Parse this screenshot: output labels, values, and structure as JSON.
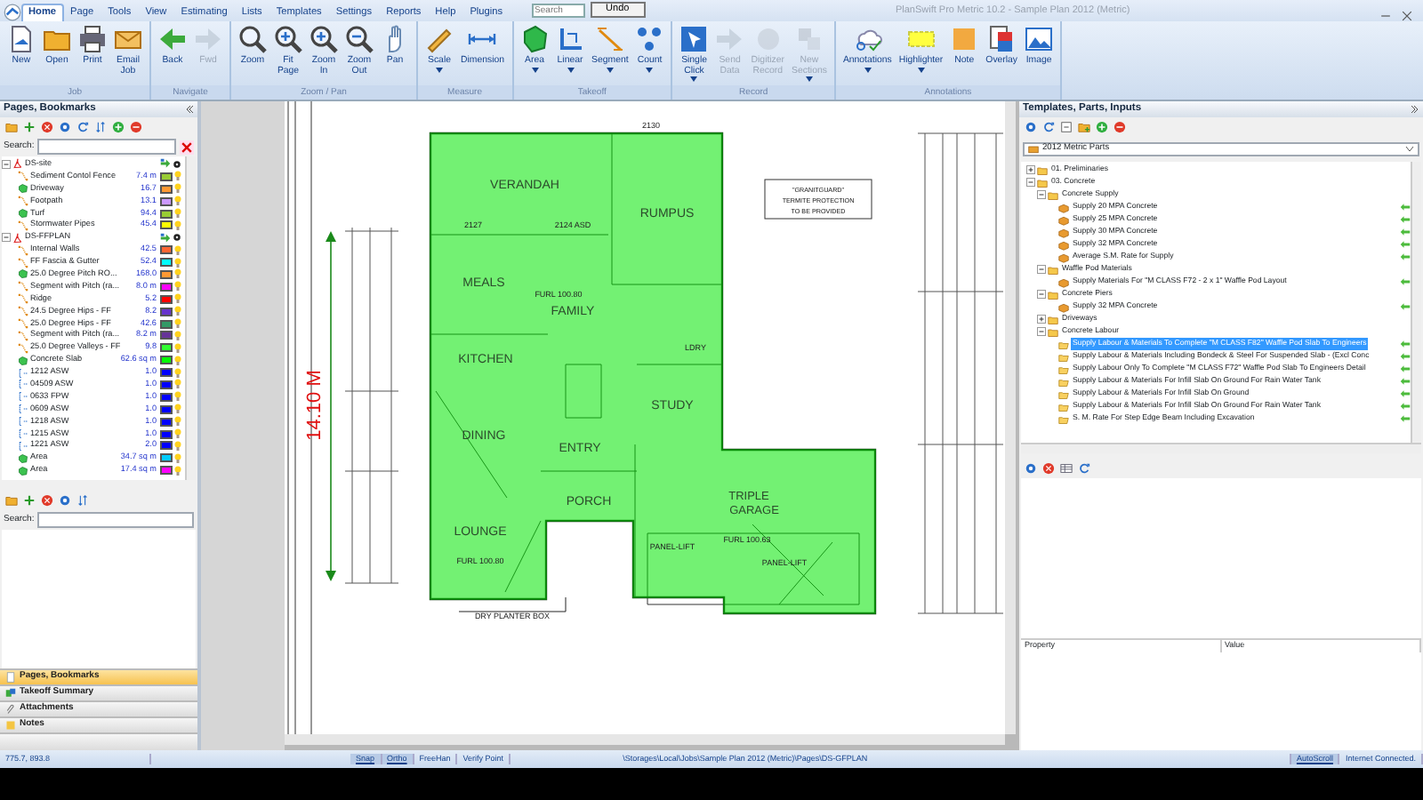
{
  "window": {
    "title": "PlanSwift Pro Metric 10.2 - Sample Plan 2012 (Metric)"
  },
  "menu_tabs": [
    {
      "label": "Home",
      "selected": true
    },
    {
      "label": "Page",
      "selected": false
    },
    {
      "label": "Tools",
      "selected": false
    },
    {
      "label": "View",
      "selected": false
    },
    {
      "label": "Estimating",
      "selected": false
    },
    {
      "label": "Lists",
      "selected": false
    },
    {
      "label": "Templates",
      "selected": false
    },
    {
      "label": "Settings",
      "selected": false
    },
    {
      "label": "Reports",
      "selected": false
    },
    {
      "label": "Help",
      "selected": false
    },
    {
      "label": "Plugins",
      "selected": false
    }
  ],
  "search": {
    "placeholder": "Search"
  },
  "undo_button": "Undo",
  "ribbon": [
    {
      "group": "Job",
      "buttons": [
        {
          "label": "New",
          "disabled": false,
          "dropdown": false
        },
        {
          "label": "Open",
          "disabled": false,
          "dropdown": false
        },
        {
          "label": "Print",
          "disabled": false,
          "dropdown": false
        },
        {
          "label": "Email Job",
          "disabled": false,
          "dropdown": false
        }
      ]
    },
    {
      "group": "Navigate",
      "buttons": [
        {
          "label": "Back",
          "disabled": false,
          "dropdown": false
        },
        {
          "label": "Fwd",
          "disabled": true,
          "dropdown": false
        }
      ]
    },
    {
      "group": "Zoom / Pan",
      "buttons": [
        {
          "label": "Zoom",
          "disabled": false,
          "dropdown": false
        },
        {
          "label": "Fit Page",
          "disabled": false,
          "dropdown": false
        },
        {
          "label": "Zoom In",
          "disabled": false,
          "dropdown": false
        },
        {
          "label": "Zoom Out",
          "disabled": false,
          "dropdown": false
        },
        {
          "label": "Pan",
          "disabled": false,
          "dropdown": false
        }
      ]
    },
    {
      "group": "Measure",
      "buttons": [
        {
          "label": "Scale",
          "disabled": false,
          "dropdown": true
        },
        {
          "label": "Dimension",
          "disabled": false,
          "dropdown": false
        }
      ]
    },
    {
      "group": "Takeoff",
      "buttons": [
        {
          "label": "Area",
          "disabled": false,
          "dropdown": true
        },
        {
          "label": "Linear",
          "disabled": false,
          "dropdown": true
        },
        {
          "label": "Segment",
          "disabled": false,
          "dropdown": true
        },
        {
          "label": "Count",
          "disabled": false,
          "dropdown": true
        }
      ]
    },
    {
      "group": "Record",
      "buttons": [
        {
          "label": "Single Click",
          "disabled": false,
          "dropdown": true
        },
        {
          "label": "Send Data",
          "disabled": true,
          "dropdown": false
        },
        {
          "label": "Digitizer Record",
          "disabled": true,
          "dropdown": false
        },
        {
          "label": "New Sections",
          "disabled": true,
          "dropdown": true
        }
      ]
    },
    {
      "group": "Annotations",
      "buttons": [
        {
          "label": "Annotations",
          "disabled": false,
          "dropdown": true
        },
        {
          "label": "Highlighter",
          "disabled": false,
          "dropdown": true
        },
        {
          "label": "Note",
          "disabled": false,
          "dropdown": false
        },
        {
          "label": "Overlay",
          "disabled": false,
          "dropdown": false
        },
        {
          "label": "Image",
          "disabled": false,
          "dropdown": false
        }
      ]
    }
  ],
  "pages_panel": {
    "title": "Pages, Bookmarks",
    "search_label": "Search:",
    "tree": [
      {
        "label": "DS-site",
        "expanded": true,
        "children": [
          {
            "label": "Sediment Contol Fence",
            "kind": "linear",
            "value": "7.4 m",
            "color": "#99cc33"
          },
          {
            "label": "Driveway",
            "kind": "area",
            "value": "16.7",
            "color": "#ff9933"
          },
          {
            "label": "Footpath",
            "kind": "linear",
            "value": "13.1",
            "color": "#cc99ff"
          },
          {
            "label": "Turf",
            "kind": "area",
            "value": "94.4",
            "color": "#99cc33"
          },
          {
            "label": "Stormwater Pipes",
            "kind": "linear",
            "value": "45.4",
            "color": "#ffff00"
          }
        ]
      },
      {
        "label": "DS-FFPLAN",
        "expanded": true,
        "children": [
          {
            "label": "Internal Walls",
            "kind": "linear",
            "value": "42.5",
            "color": "#ff6633"
          },
          {
            "label": "FF Fascia & Gutter",
            "kind": "linear",
            "value": "52.4",
            "color": "#00ffff"
          },
          {
            "label": "25.0 Degree Pitch  RO...",
            "kind": "area",
            "value": "168.0",
            "color": "#ff9933"
          },
          {
            "label": "Segment with Pitch (ra...",
            "kind": "linear",
            "value": "8.0 m",
            "color": "#ff00ff"
          },
          {
            "label": "Ridge",
            "kind": "linear",
            "value": "5.2",
            "color": "#ff0000"
          },
          {
            "label": "24.5 Degree Hips - FF",
            "kind": "linear",
            "value": "8.2",
            "color": "#6633cc"
          },
          {
            "label": "25.0 Degree Hips - FF",
            "kind": "linear",
            "value": "42.6",
            "color": "#339966"
          },
          {
            "label": "Segment with Pitch (ra...",
            "kind": "linear",
            "value": "8.2 m",
            "color": "#663399"
          },
          {
            "label": "25.0 Degree  Valleys - FF",
            "kind": "linear",
            "value": "9.8",
            "color": "#33ff33"
          },
          {
            "label": "Concrete Slab",
            "kind": "area",
            "value": "62.6 sq m",
            "color": "#00ff00"
          },
          {
            "label": "1212 ASW",
            "kind": "count",
            "value": "1.0",
            "color": "#0000ff"
          },
          {
            "label": "04509 ASW",
            "kind": "count",
            "value": "1.0",
            "color": "#0000ff"
          },
          {
            "label": "0633 FPW",
            "kind": "count",
            "value": "1.0",
            "color": "#0000ff"
          },
          {
            "label": "0609 ASW",
            "kind": "count",
            "value": "1.0",
            "color": "#0000ff"
          },
          {
            "label": "1218 ASW",
            "kind": "count",
            "value": "1.0",
            "color": "#0000ff"
          },
          {
            "label": "1215 ASW",
            "kind": "count",
            "value": "1.0",
            "color": "#0000ff"
          },
          {
            "label": "1221 ASW",
            "kind": "count",
            "value": "2.0",
            "color": "#0000ff"
          },
          {
            "label": "Area",
            "kind": "area",
            "value": "34.7 sq m",
            "color": "#00ccff"
          },
          {
            "label": "Area",
            "kind": "area",
            "value": "17.4 sq m",
            "color": "#ff00ff"
          }
        ]
      }
    ]
  },
  "lower_left_panel": {
    "search_label": "Search:"
  },
  "accordion": [
    {
      "label": "Pages, Bookmarks",
      "selected": true
    },
    {
      "label": "Takeoff Summary",
      "selected": false
    },
    {
      "label": "Attachments",
      "selected": false
    },
    {
      "label": "Notes",
      "selected": false
    }
  ],
  "plan": {
    "labels": [
      "VERANDAH",
      "RUMPUS",
      "MEALS",
      "FAMILY",
      "KITCHEN",
      "DINING",
      "ENTRY",
      "STUDY",
      "PORCH",
      "LOUNGE",
      "TRIPLE",
      "GARAGE",
      "2130",
      "2127",
      "2124 ASD",
      "FURL 100.80",
      "FURL 100.80",
      "FURL 100.63",
      "PANEL-LIFT",
      "PANEL-LIFT",
      "LDRY",
      "DRY PLANTER BOX"
    ],
    "note": [
      "\"GRANITGUARD\"",
      "TERMITE PROTECTION",
      "TO BE PROVIDED"
    ],
    "dimension": "14.10 M"
  },
  "templates_panel": {
    "title": "Templates, Parts, Inputs",
    "dropdown": "2012 Metric Parts",
    "tree": [
      {
        "label": "01. Preliminaries",
        "kind": "folder",
        "expanded": false,
        "selected": false
      },
      {
        "label": "03. Concrete",
        "kind": "folder",
        "expanded": true,
        "selected": false,
        "children": [
          {
            "label": "Concrete Supply",
            "kind": "folder",
            "expanded": true,
            "selected": false,
            "children": [
              {
                "label": "Supply 20 MPA Concrete",
                "kind": "part",
                "selected": false
              },
              {
                "label": "Supply 25 MPA Concrete",
                "kind": "part",
                "selected": false
              },
              {
                "label": "Supply 30 MPA Concrete",
                "kind": "part",
                "selected": false
              },
              {
                "label": "Supply 32 MPA Concrete",
                "kind": "part",
                "selected": false
              },
              {
                "label": "Average S.M. Rate for Supply",
                "kind": "part",
                "selected": false
              }
            ]
          },
          {
            "label": "Waffle Pod Materials",
            "kind": "folder",
            "expanded": true,
            "selected": false,
            "children": [
              {
                "label": "Supply Materials For \"M CLASS F72 - 2 x 1\"  Waffle Pod Layout",
                "kind": "part",
                "selected": false
              }
            ]
          },
          {
            "label": "Concrete Piers",
            "kind": "folder",
            "expanded": true,
            "selected": false,
            "children": [
              {
                "label": "Supply 32 MPA Concrete",
                "kind": "part",
                "selected": false
              }
            ]
          },
          {
            "label": "Driveways",
            "kind": "folder",
            "expanded": false,
            "selected": false
          },
          {
            "label": "Concrete Labour",
            "kind": "folder",
            "expanded": true,
            "selected": false,
            "children": [
              {
                "label": "Supply Labour & Materials To Complete \"M CLASS F82\"  Waffle Pod Slab To Engineers",
                "kind": "assembly",
                "selected": true
              },
              {
                "label": "Supply Labour & Materials Including Bondeck & Steel For Suspended Slab - (Excl Conc",
                "kind": "assembly",
                "selected": false
              },
              {
                "label": "Supply Labour Only To Complete \"M CLASS F72\"  Waffle Pod Slab To Engineers Detail",
                "kind": "assembly",
                "selected": false
              },
              {
                "label": "Supply Labour & Materials For Infill Slab On Ground For Rain Water Tank",
                "kind": "assembly",
                "selected": false
              },
              {
                "label": "Supply Labour & Materials For Infill Slab On Ground",
                "kind": "assembly",
                "selected": false
              },
              {
                "label": "Supply Labour & Materials For Infill Slab On Ground For Rain Water Tank",
                "kind": "assembly",
                "selected": false
              },
              {
                "label": "S. M. Rate For Step Edge Beam Including Excavation",
                "kind": "assembly",
                "selected": false
              }
            ]
          }
        ]
      }
    ]
  },
  "properties_table": {
    "columns": [
      "Property",
      "Value"
    ]
  },
  "status_bar": {
    "coordinates": "775.7, 893.8",
    "toggles": [
      {
        "label": "Snap",
        "on": true
      },
      {
        "label": "Ortho",
        "on": true
      },
      {
        "label": "FreeHan",
        "on": false
      },
      {
        "label": "Verify Point",
        "on": false
      }
    ],
    "path": "\\Storages\\Local\\Jobs\\Sample Plan 2012 (Metric)\\Pages\\DS-GFPLAN",
    "autoscroll": {
      "label": "AutoScroll",
      "on": true
    },
    "connection": "Internet Connected."
  }
}
